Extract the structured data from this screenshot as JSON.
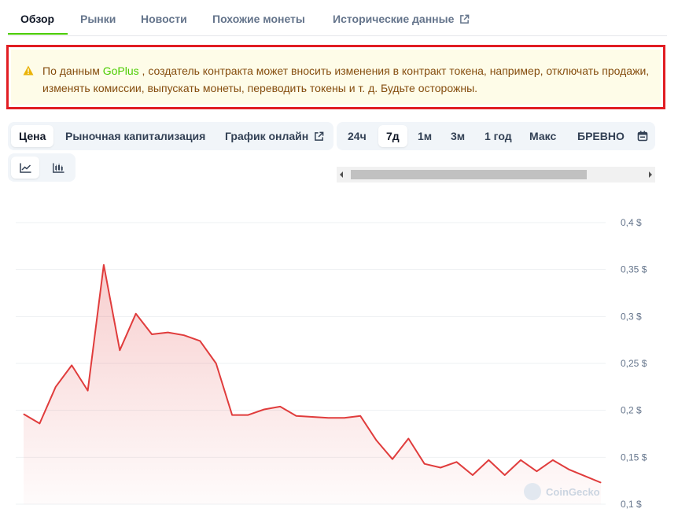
{
  "tabs": [
    {
      "label": "Обзор",
      "active": true
    },
    {
      "label": "Рынки"
    },
    {
      "label": "Новости"
    },
    {
      "label": "Похожие монеты"
    },
    {
      "label": "Исторические данные",
      "external": true
    }
  ],
  "warning": {
    "prefix": "По данным ",
    "link": "GoPlus",
    "text": " , создатель контракта может вносить изменения в контракт токена, например, отключать продажи, изменять комиссии, выпускать монеты, переводить токены и т. д. Будьте осторожны."
  },
  "chart_tabs": [
    {
      "label": "Цена",
      "active": true
    },
    {
      "label": "Рыночная капитализация"
    },
    {
      "label": "График онлайн",
      "external": true
    }
  ],
  "range_tabs": [
    {
      "label": "24ч"
    },
    {
      "label": "7д",
      "active": true
    },
    {
      "label": "1м"
    },
    {
      "label": "3м"
    },
    {
      "label": "1 год"
    },
    {
      "label": "Макс"
    },
    {
      "label": "БРЕВНО"
    }
  ],
  "icons": {
    "calendar": "calendar-icon",
    "line_chart": "line-chart-icon",
    "candles": "candlestick-icon",
    "warning": "warning-triangle-icon"
  },
  "colors": {
    "accent": "#4bcc00",
    "line": "#e03c3c",
    "warning_border": "#e11d23",
    "warning_bg": "#fefce8"
  },
  "watermark": "CoinGecko",
  "chart_data": {
    "type": "area",
    "ylim": [
      0.1,
      0.4
    ],
    "y_ticks": [
      {
        "value": 0.4,
        "label": "0,4 $"
      },
      {
        "value": 0.35,
        "label": "0,35 $"
      },
      {
        "value": 0.3,
        "label": "0,3 $"
      },
      {
        "value": 0.25,
        "label": "0,25 $"
      },
      {
        "value": 0.2,
        "label": "0,2 $"
      },
      {
        "value": 0.15,
        "label": "0,15 $"
      },
      {
        "value": 0.1,
        "label": "0,1 $"
      }
    ],
    "grid": true,
    "series": [
      {
        "values": [
          0.196,
          0.186,
          0.225,
          0.248,
          0.221,
          0.355,
          0.264,
          0.303,
          0.281,
          0.283,
          0.28,
          0.274,
          0.25,
          0.195,
          0.195,
          0.201,
          0.204,
          0.194,
          0.193,
          0.192,
          0.192,
          0.194,
          0.168,
          0.148,
          0.17,
          0.143,
          0.139,
          0.145,
          0.131,
          0.147,
          0.131,
          0.147,
          0.135,
          0.147,
          0.137,
          0.13,
          0.123
        ]
      }
    ]
  }
}
